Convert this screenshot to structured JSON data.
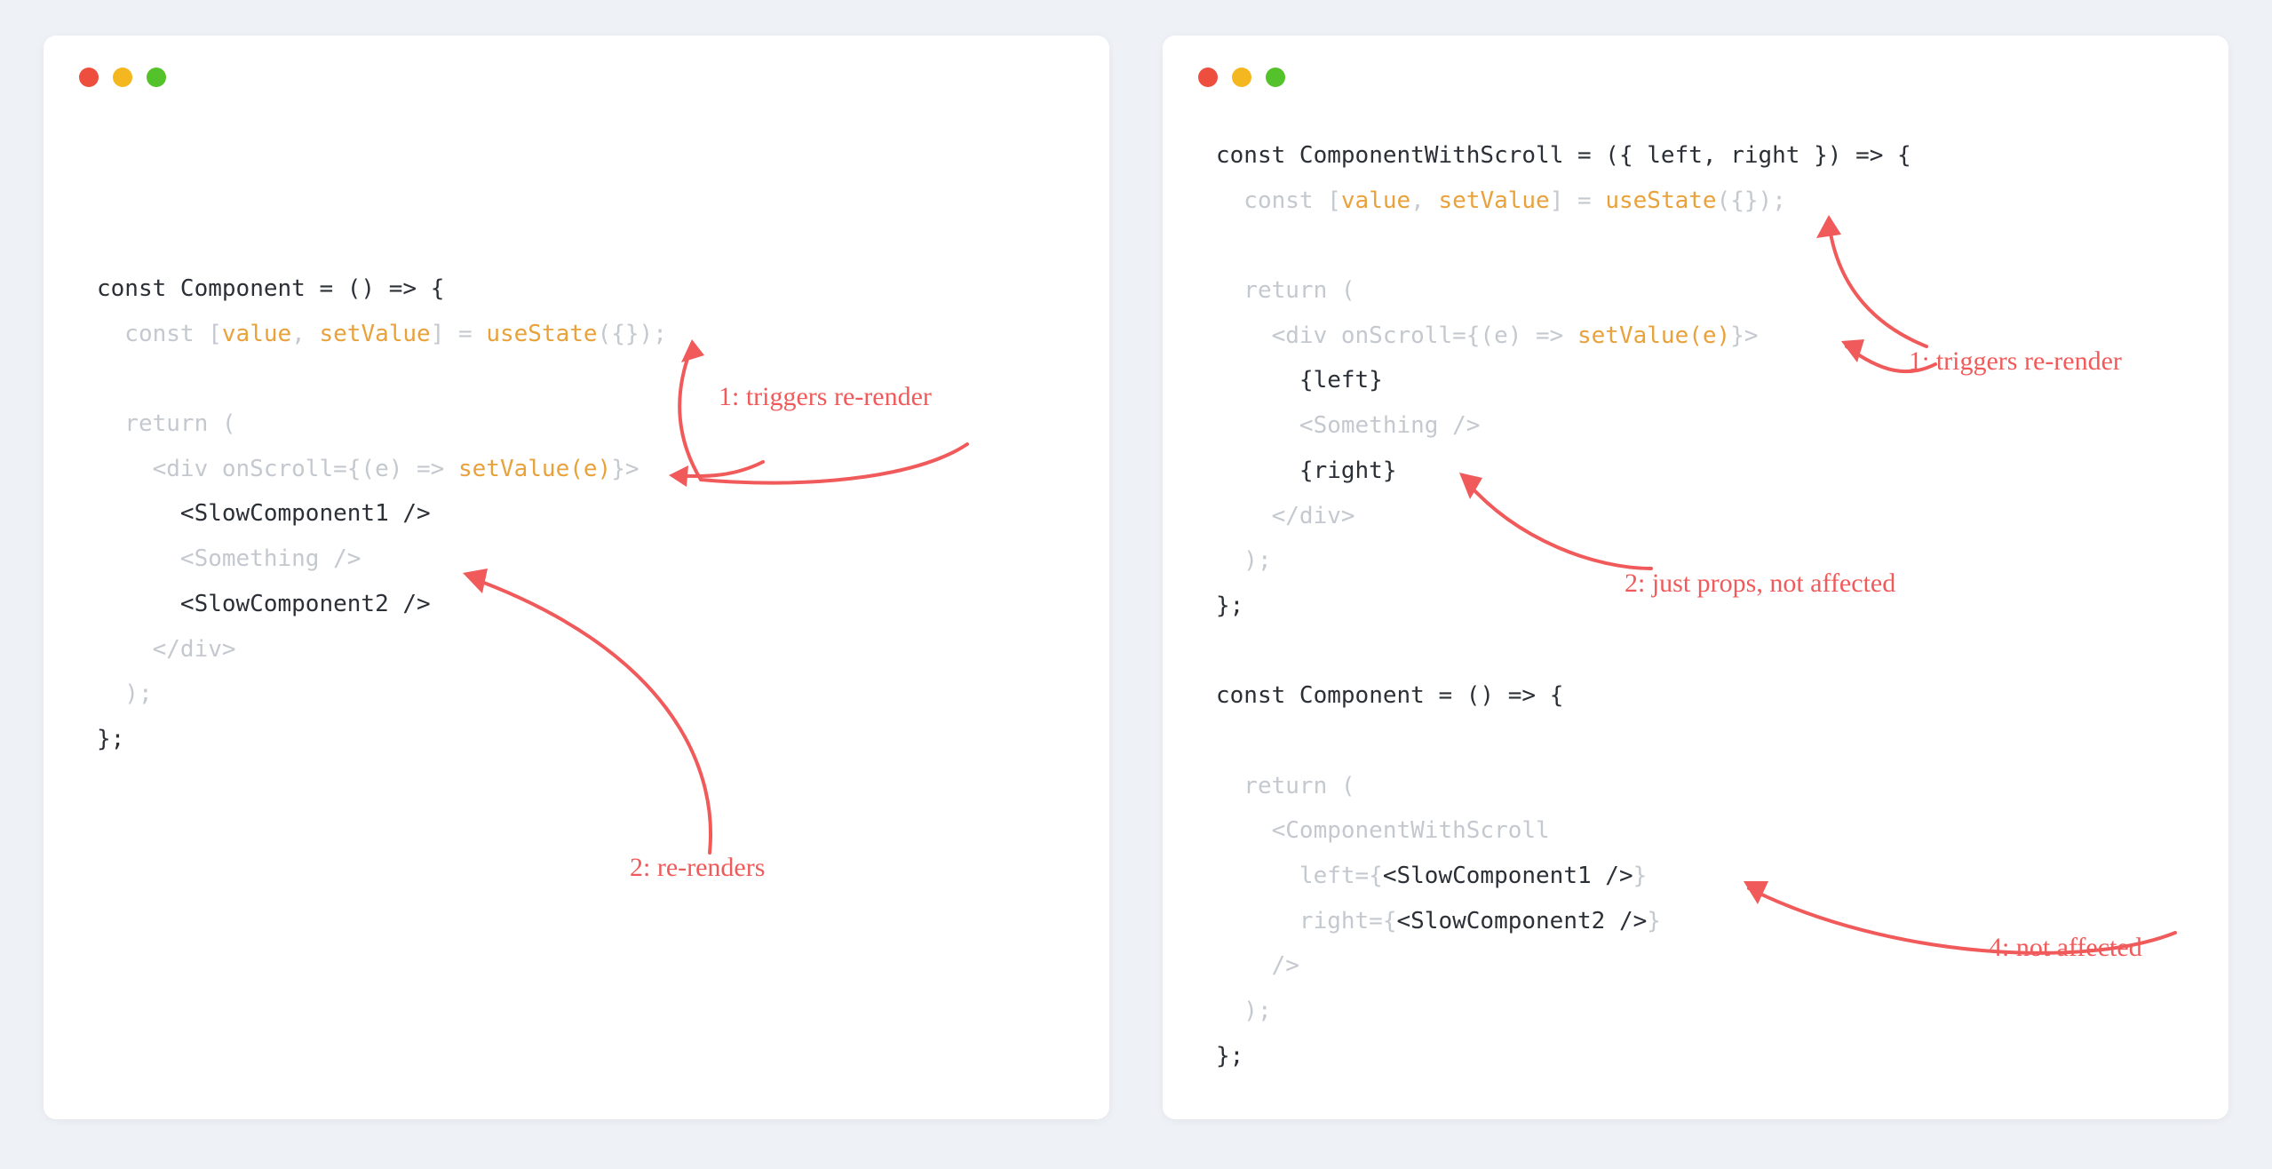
{
  "left": {
    "code": {
      "l1a": "const",
      "l1b": " Component = () => {",
      "l2a": "  const",
      "l2b": " [",
      "l2c": "value",
      "l2d": ", ",
      "l2e": "setValue",
      "l2f": "] = ",
      "l2g": "useState",
      "l2h": "({});",
      "l3a": "  return",
      "l3b": " (",
      "l4a": "    <div onScroll={(e) => ",
      "l4b": "setValue(e)",
      "l4c": "}>",
      "l5": "      <SlowComponent1 />",
      "l6": "      <Something />",
      "l7": "      <SlowComponent2 />",
      "l8": "    </div>",
      "l9": "  );",
      "l10": "};"
    },
    "annotations": {
      "a1": "1: triggers re-render",
      "a2": "2: re-renders"
    }
  },
  "right": {
    "code": {
      "r1a": "const",
      "r1b": " ComponentWithScroll = ({ left, right }) => {",
      "r2a": "  const",
      "r2b": " [",
      "r2c": "value",
      "r2d": ", ",
      "r2e": "setValue",
      "r2f": "] = ",
      "r2g": "useState",
      "r2h": "({});",
      "r3a": "  return",
      "r3b": " (",
      "r4a": "    <div onScroll={(e) => ",
      "r4b": "setValue(e)",
      "r4c": "}>",
      "r5": "      {left}",
      "r6": "      <Something />",
      "r7": "      {right}",
      "r8": "    </div>",
      "r9": "  );",
      "r10": "};",
      "r11a": "const",
      "r11b": " Component = () => {",
      "r12a": "  return",
      "r12b": " (",
      "r13": "    <ComponentWithScroll",
      "r14a": "      left={",
      "r14b": "<SlowComponent1 />",
      "r14c": "}",
      "r15a": "      right={",
      "r15b": "<SlowComponent2 />",
      "r15c": "}",
      "r16": "    />",
      "r17": "  );",
      "r18": "};"
    },
    "annotations": {
      "a1": "1: triggers re-render",
      "a2": "2: just props, not affected",
      "a4": "4: not affected"
    }
  }
}
